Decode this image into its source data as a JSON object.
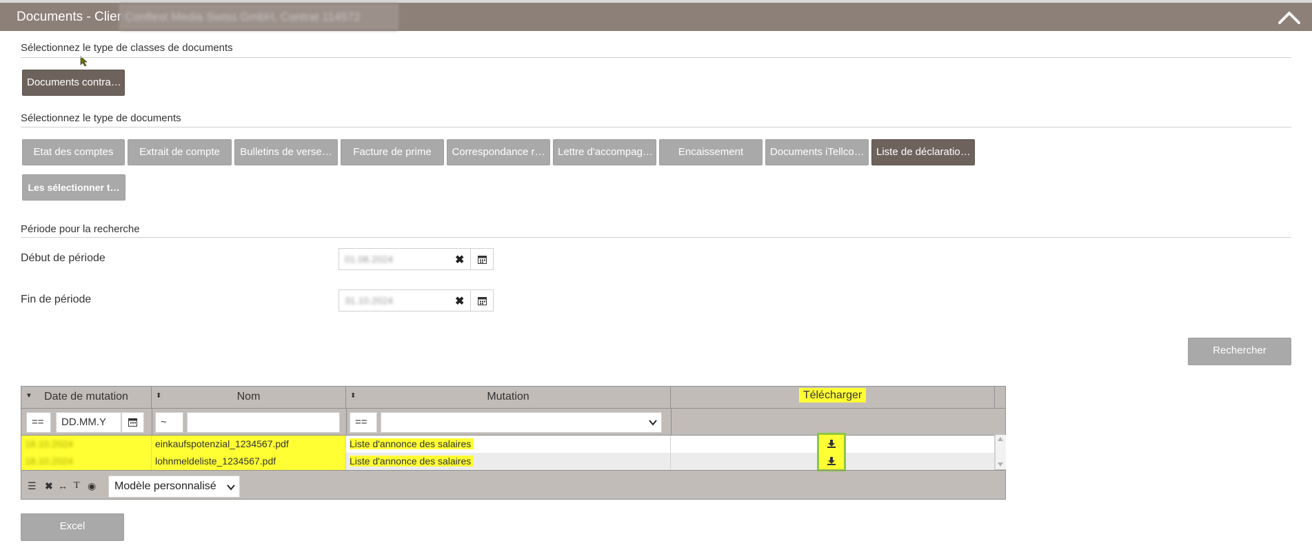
{
  "header": {
    "title": "Documents - Client",
    "client_name": "Conflest Media Swiss GmbH, Contrat 114572"
  },
  "doc_class": {
    "label": "Sélectionnez le type de classes de documents",
    "buttons": [
      "Documents contra…"
    ]
  },
  "doc_type": {
    "label": "Sélectionnez le type de documents",
    "buttons": [
      "Etat des comptes",
      "Extrait de compte",
      "Bulletins de verse…",
      "Facture de prime",
      "Correspondance r…",
      "Lettre d'accompag…",
      "Encaissement",
      "Documents iTellco…",
      "Liste de déclaratio…"
    ],
    "select_all": "Les sélectionner t…"
  },
  "period": {
    "label": "Période pour la recherche",
    "start_label": "Début de période",
    "start_value": "01.08.2024",
    "end_label": "Fin de période",
    "end_value": "31.10.2024"
  },
  "search_button": "Rechercher",
  "grid": {
    "columns": [
      "Date de mutation",
      "Nom",
      "Mutation",
      "Télécharger"
    ],
    "filters": {
      "date_op": "==",
      "date_placeholder": "DD.MM.Y",
      "name_op": "~",
      "name_value": "",
      "mutation_op": "==",
      "mutation_value": ""
    },
    "rows": [
      {
        "date": "18.10.2024",
        "name": "einkaufspotenzial_1234567.pdf",
        "mutation": "Liste d'annonce des salaires"
      },
      {
        "date": "18.10.2024",
        "name": "lohnmeldeliste_1234567.pdf",
        "mutation": "Liste d'annonce des salaires"
      }
    ],
    "template_select": "Modèle personnalisé"
  },
  "excel_button": "Excel",
  "colors": {
    "header_bg": "#8d8079",
    "button_grey": "#a9a9a9",
    "button_dark": "#6e625c",
    "highlight": "#ffff33",
    "download_border": "#8dc63f"
  }
}
